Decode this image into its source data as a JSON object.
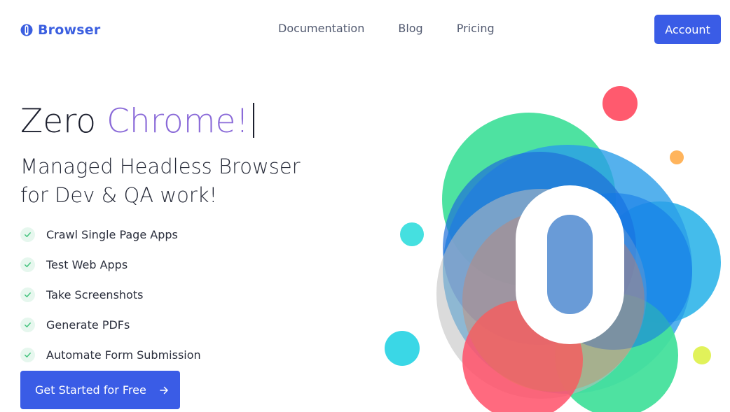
{
  "brand": {
    "name": "Browser",
    "color": "#3b5fe0"
  },
  "nav": {
    "links": [
      {
        "label": "Documentation"
      },
      {
        "label": "Blog"
      },
      {
        "label": "Pricing"
      }
    ],
    "account_label": "Account"
  },
  "hero": {
    "title_plain": "Zero ",
    "title_accent": "Chrome!",
    "subtitle_line1": "Managed Headless Browser",
    "subtitle_line2": "for Dev & QA work!"
  },
  "features": [
    {
      "label": "Crawl Single Page Apps",
      "icon": "check-icon"
    },
    {
      "label": "Test Web Apps",
      "icon": "check-icon"
    },
    {
      "label": "Take Screenshots",
      "icon": "check-icon"
    },
    {
      "label": "Generate PDFs",
      "icon": "check-icon"
    },
    {
      "label": "Automate Form Submission",
      "icon": "check-icon"
    }
  ],
  "cta": {
    "label": "Get Started for Free",
    "icon": "arrow-right-icon"
  },
  "colors": {
    "primary": "#3a5ce6",
    "accent_purple": "#8a6ad8",
    "check_green": "#3ec27a"
  }
}
